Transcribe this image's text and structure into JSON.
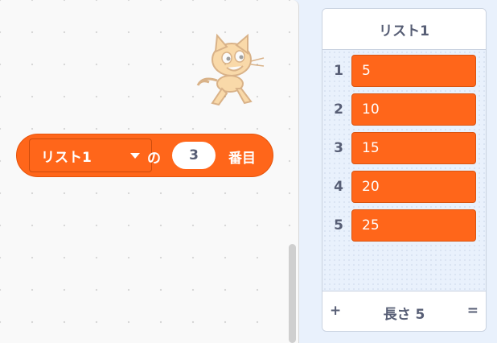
{
  "block": {
    "list_dropdown": "リスト1",
    "of_label": "の",
    "index_value": "3",
    "suffix_label": "番目"
  },
  "monitor": {
    "title": "リスト1",
    "items": [
      {
        "index": "1",
        "value": "5"
      },
      {
        "index": "2",
        "value": "10"
      },
      {
        "index": "3",
        "value": "15"
      },
      {
        "index": "4",
        "value": "20"
      },
      {
        "index": "5",
        "value": "25"
      }
    ],
    "footer": {
      "add_label": "+",
      "length_label": "長さ 5",
      "resize_label": "="
    }
  },
  "colors": {
    "block_orange": "#ff661a",
    "monitor_background": "#e9f1fc",
    "text_gray": "#575e75"
  },
  "icons": {
    "sprite": "scratch-cat-icon",
    "dropdown": "caret-down-icon"
  }
}
